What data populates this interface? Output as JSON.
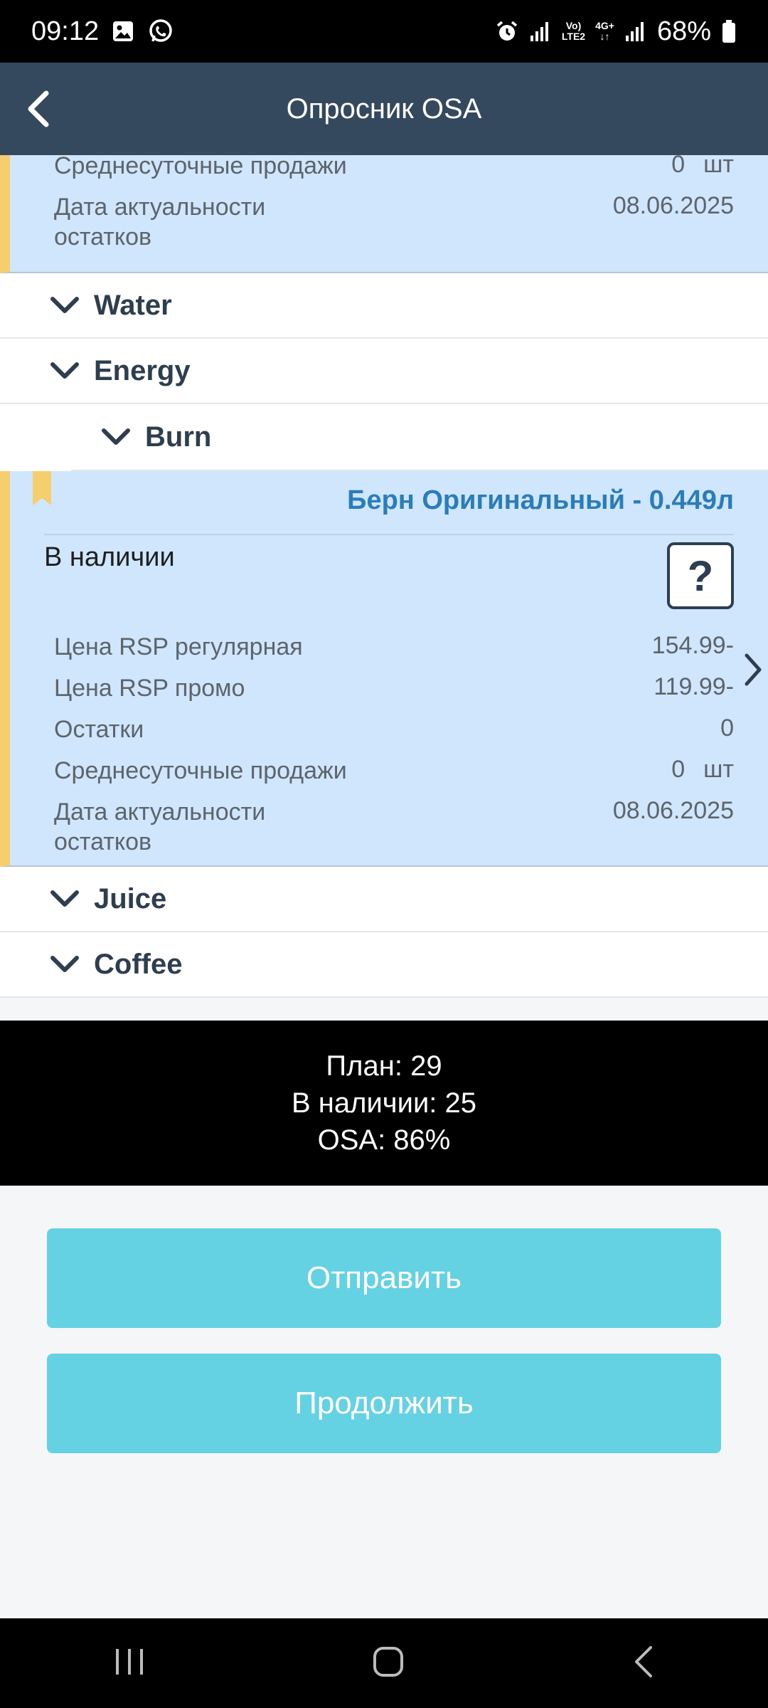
{
  "status_bar": {
    "time": "09:12",
    "network_top": "Vo)",
    "network_bottom": "LTE2",
    "network2_top": "4G+",
    "battery": "68%"
  },
  "app_bar": {
    "title": "Опросник OSA",
    "back_icon": "chevron-left-icon"
  },
  "prev_card": {
    "rows": [
      {
        "label": "Среднесуточные продажи",
        "value": "0",
        "unit": "шт"
      },
      {
        "label": "Дата актуальности\nостатков",
        "value": "08.06.2025"
      }
    ]
  },
  "categories": {
    "water": "Water",
    "energy": "Energy",
    "burn": "Burn",
    "juice": "Juice",
    "coffee": "Coffee"
  },
  "product_card": {
    "title": "Берн Оригинальный - 0.449л",
    "availability_label": "В наличии",
    "availability_value": "?",
    "rows": [
      {
        "label": "Цена RSP регулярная",
        "value": "154.99-"
      },
      {
        "label": "Цена RSP промо",
        "value": "119.99-"
      },
      {
        "label": "Остатки",
        "value": "0"
      },
      {
        "label": "Среднесуточные продажи",
        "value": "0",
        "unit": "шт"
      },
      {
        "label": "Дата актуальности\nостатков",
        "value": "08.06.2025"
      }
    ]
  },
  "summary": {
    "plan": "План: 29",
    "available": "В наличии: 25",
    "osa": "OSA: 86%"
  },
  "buttons": {
    "send": "Отправить",
    "continue": "Продолжить"
  },
  "colors": {
    "accent": "#64d2e2",
    "header": "#34495e",
    "card": "#cfe6fc",
    "marker": "#f5cf6e",
    "title": "#2a7db9"
  }
}
